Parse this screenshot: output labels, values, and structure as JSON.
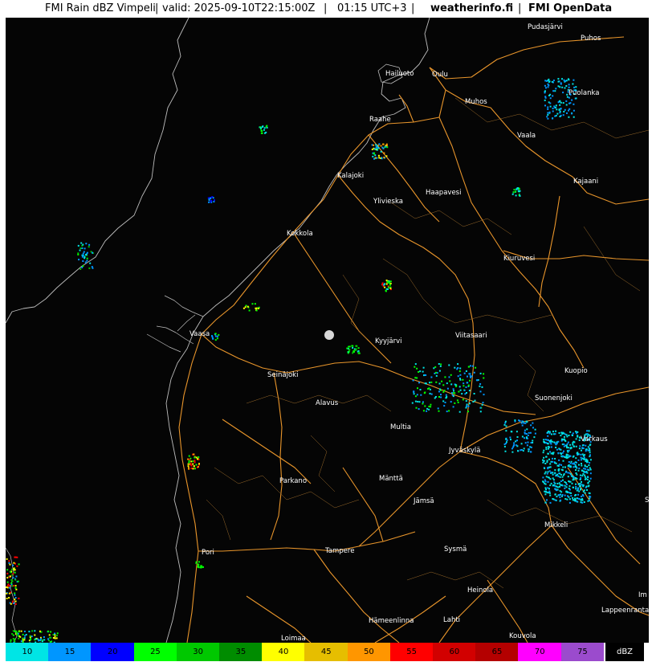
{
  "header": {
    "title": "FMI Rain dBZ Vimpeli",
    "sep1": "|",
    "valid": "valid: 2025-09-10T22:15:00Z",
    "sep2": "|",
    "local_time": "01:15 UTC+3",
    "sep3": "|",
    "site": "weatherinfo.fi",
    "sep4": "|",
    "source": "FMI OpenData"
  },
  "map": {
    "background_color": "#050505",
    "coast_color": "#bdbdbd",
    "road_color": "#e8952b",
    "radar_site": "Vimpeli",
    "cities": [
      {
        "name": "Pudasjärvi"
      },
      {
        "name": "Puhos"
      },
      {
        "name": "Hailuoto"
      },
      {
        "name": "Oulu"
      },
      {
        "name": "Muhos"
      },
      {
        "name": "Puolanka"
      },
      {
        "name": "Raahe"
      },
      {
        "name": "Vaala"
      },
      {
        "name": "Kalajoki"
      },
      {
        "name": "Kajaani"
      },
      {
        "name": "Haapavesi"
      },
      {
        "name": "Ylivieska"
      },
      {
        "name": "Kokkola"
      },
      {
        "name": "Kiuruvesi"
      },
      {
        "name": "Vaasa"
      },
      {
        "name": "Kyyjärvi"
      },
      {
        "name": "Viitasaari"
      },
      {
        "name": "Kuopio"
      },
      {
        "name": "Seinäjoki"
      },
      {
        "name": "Alavus"
      },
      {
        "name": "Suonenjoki"
      },
      {
        "name": "Multia"
      },
      {
        "name": "Varkaus"
      },
      {
        "name": "Jyväskylä"
      },
      {
        "name": "Parkano"
      },
      {
        "name": "Mänttä"
      },
      {
        "name": "Jämsä"
      },
      {
        "name": "S"
      },
      {
        "name": "Mikkeli"
      },
      {
        "name": "Pori"
      },
      {
        "name": "Tampere"
      },
      {
        "name": "Sysmä"
      },
      {
        "name": "Heinola"
      },
      {
        "name": "Im"
      },
      {
        "name": "Lappeenranta"
      },
      {
        "name": "Hämeenlinna"
      },
      {
        "name": "Lahti"
      },
      {
        "name": "Loimaa"
      },
      {
        "name": "Kouvola"
      }
    ]
  },
  "legend": {
    "unit": "dBZ",
    "bins": [
      {
        "label": "10",
        "color": "#00e5e5"
      },
      {
        "label": "15",
        "color": "#0096ff"
      },
      {
        "label": "20",
        "color": "#0000ff"
      },
      {
        "label": "25",
        "color": "#00ff00"
      },
      {
        "label": "30",
        "color": "#00c800"
      },
      {
        "label": "35",
        "color": "#008c00"
      },
      {
        "label": "40",
        "color": "#ffff00"
      },
      {
        "label": "45",
        "color": "#e6be00"
      },
      {
        "label": "50",
        "color": "#ff9600"
      },
      {
        "label": "55",
        "color": "#ff0000"
      },
      {
        "label": "60",
        "color": "#d20000"
      },
      {
        "label": "65",
        "color": "#b40000"
      },
      {
        "label": "70",
        "color": "#ff00ff"
      },
      {
        "label": "75",
        "color": "#9b4bcd"
      }
    ]
  }
}
